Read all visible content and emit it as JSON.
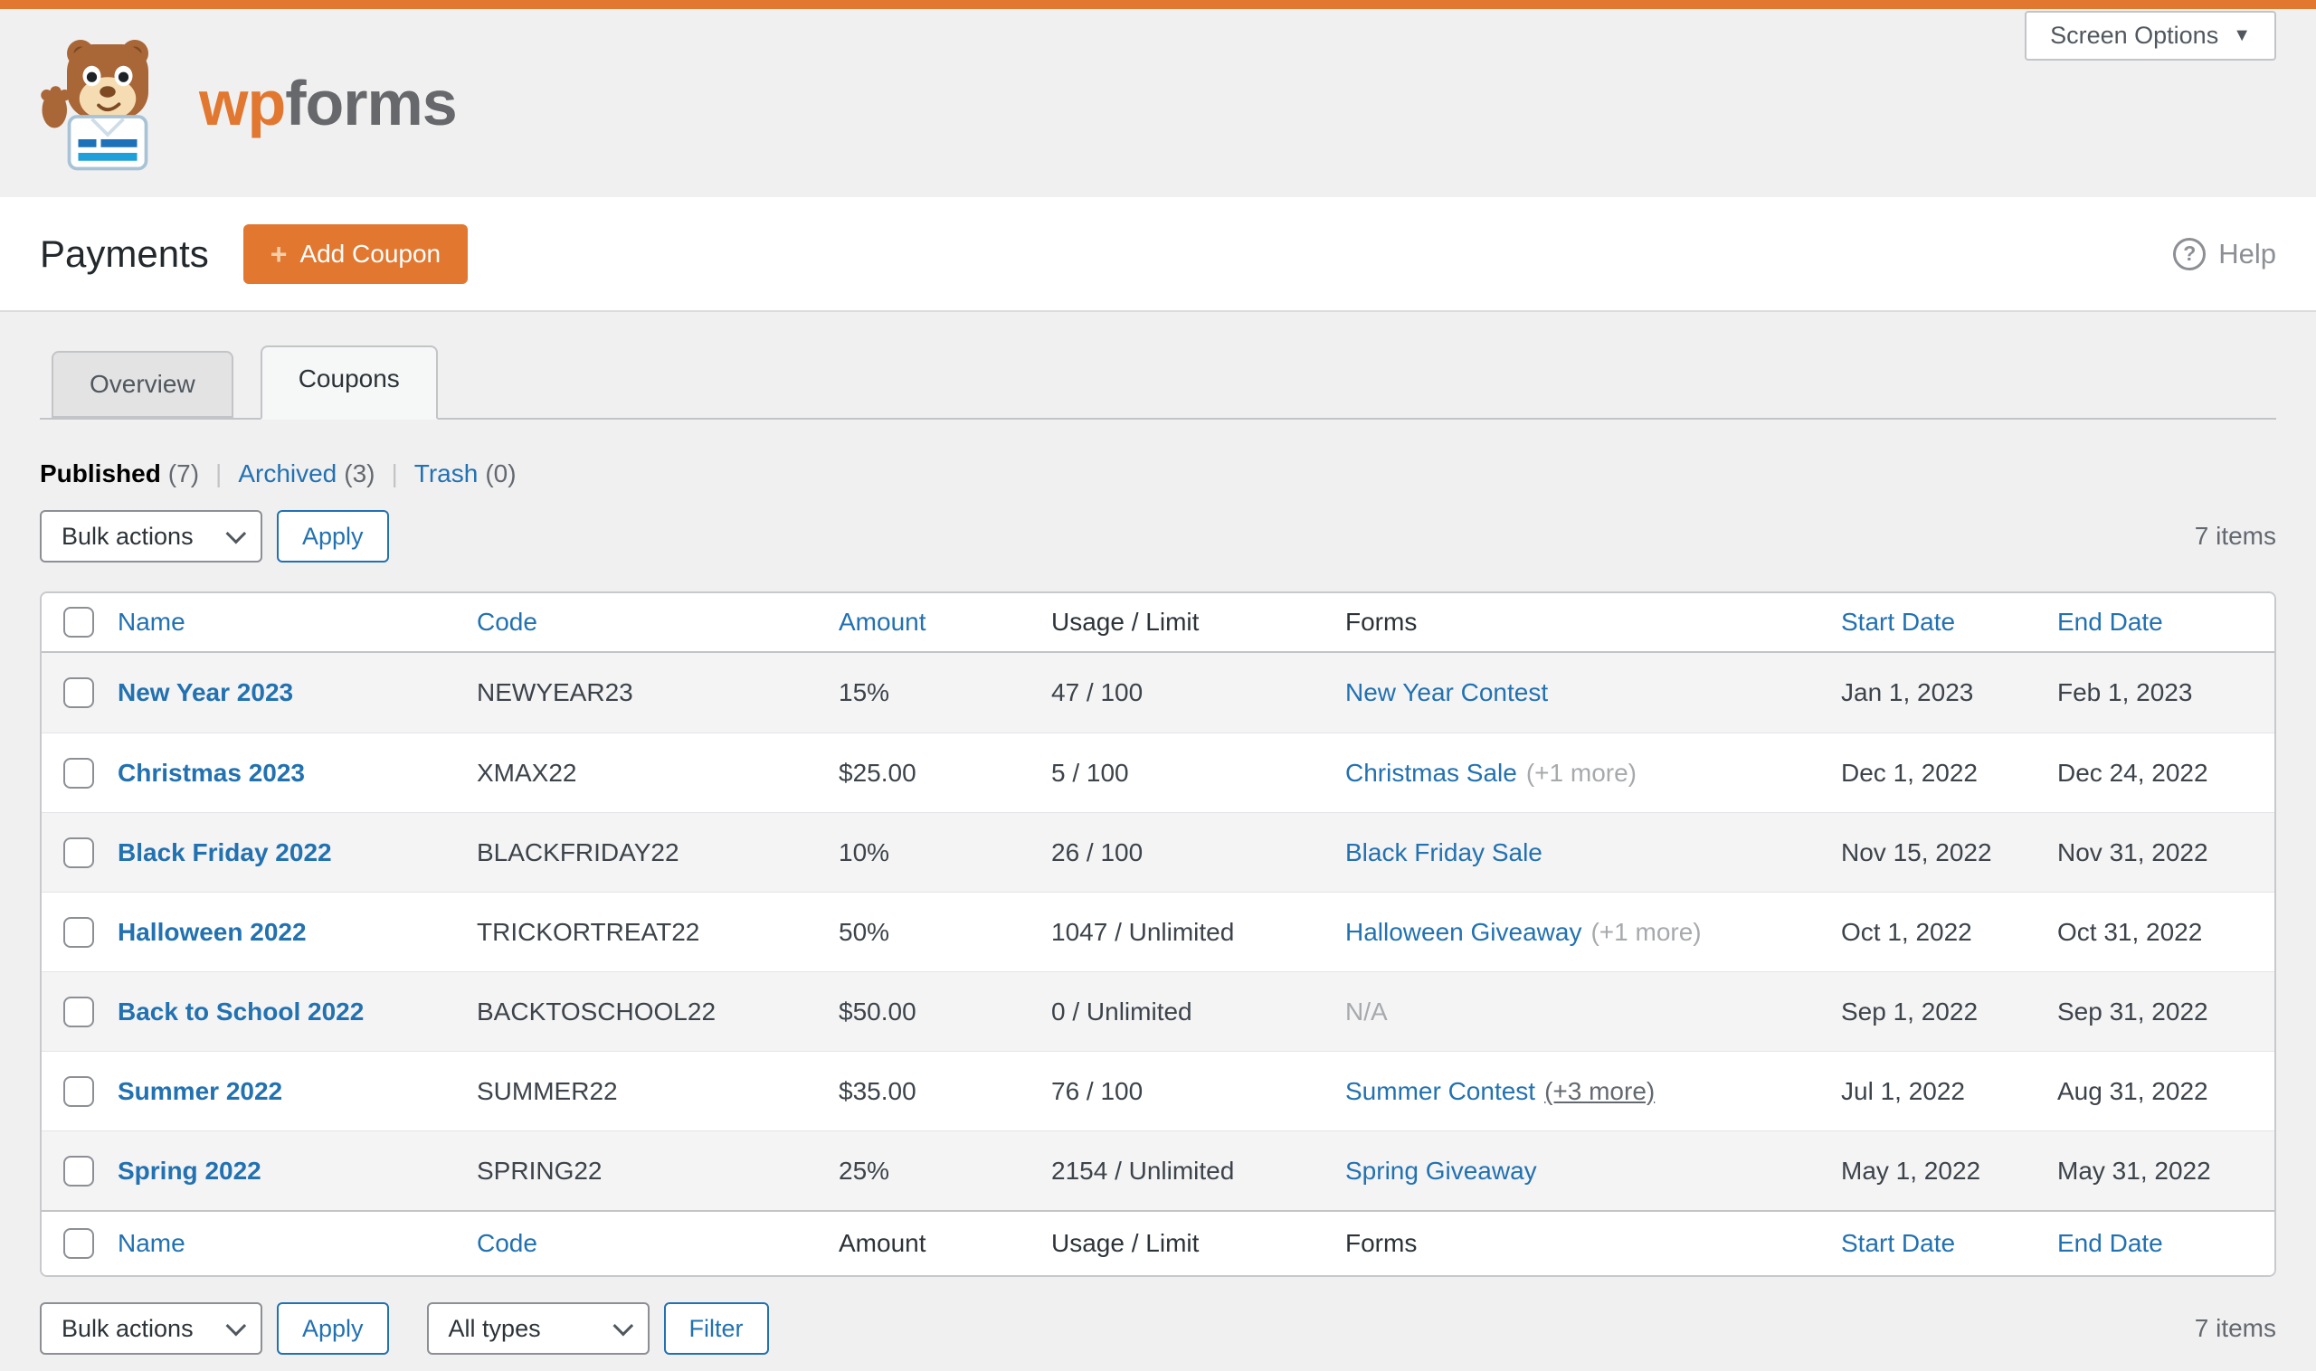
{
  "colors": {
    "accent_orange": "#e27730",
    "link_blue": "#2271b1"
  },
  "screen_options": {
    "label": "Screen Options",
    "caret": "▼"
  },
  "brand": {
    "wp": "wp",
    "forms": "forms"
  },
  "page_header": {
    "title": "Payments",
    "add_coupon_plus": "+",
    "add_coupon_label": "Add Coupon",
    "help_icon": "?",
    "help_label": "Help"
  },
  "tabs": [
    {
      "label": "Overview",
      "active": false
    },
    {
      "label": "Coupons",
      "active": true
    }
  ],
  "status_filters": [
    {
      "label": "Published",
      "count": "(7)",
      "current": true
    },
    {
      "label": "Archived",
      "count": "(3)",
      "current": false
    },
    {
      "label": "Trash",
      "count": "(0)",
      "current": false
    }
  ],
  "toolbar_top": {
    "bulk_actions": "Bulk actions",
    "apply": "Apply",
    "items_count": "7 items"
  },
  "toolbar_bottom": {
    "bulk_actions": "Bulk actions",
    "apply": "Apply",
    "type_filter": "All types",
    "filter": "Filter",
    "items_count": "7 items"
  },
  "table": {
    "header_cells": [
      {
        "label": "Name",
        "link": true
      },
      {
        "label": "Code",
        "link": true
      },
      {
        "label": "Amount",
        "link": true
      },
      {
        "label": "Usage / Limit",
        "link": false
      },
      {
        "label": "Forms",
        "link": false
      },
      {
        "label": "Start Date",
        "link": true
      },
      {
        "label": "End Date",
        "link": true
      }
    ],
    "footer_cells": [
      {
        "label": "Name",
        "link": true
      },
      {
        "label": "Code",
        "link": true
      },
      {
        "label": "Amount",
        "link": false
      },
      {
        "label": "Usage / Limit",
        "link": false
      },
      {
        "label": "Forms",
        "link": false
      },
      {
        "label": "Start Date",
        "link": true
      },
      {
        "label": "End Date",
        "link": true
      }
    ],
    "rows": [
      {
        "name": "New Year 2023",
        "code": "NEWYEAR23",
        "amount": "15%",
        "usage": "47 / 100",
        "form": "New Year Contest",
        "form_extra": "",
        "form_na": false,
        "extra_underline": false,
        "start": "Jan 1, 2023",
        "end": "Feb 1, 2023"
      },
      {
        "name": "Christmas 2023",
        "code": "XMAX22",
        "amount": "$25.00",
        "usage": "5 / 100",
        "form": "Christmas Sale",
        "form_extra": "(+1 more)",
        "form_na": false,
        "extra_underline": false,
        "start": "Dec 1, 2022",
        "end": "Dec 24, 2022"
      },
      {
        "name": "Black Friday 2022",
        "code": "BLACKFRIDAY22",
        "amount": "10%",
        "usage": "26 / 100",
        "form": "Black Friday Sale",
        "form_extra": "",
        "form_na": false,
        "extra_underline": false,
        "start": "Nov 15, 2022",
        "end": "Nov 31, 2022"
      },
      {
        "name": "Halloween 2022",
        "code": "TRICKORTREAT22",
        "amount": "50%",
        "usage": "1047 / Unlimited",
        "form": "Halloween Giveaway",
        "form_extra": "(+1 more)",
        "form_na": false,
        "extra_underline": false,
        "start": "Oct 1, 2022",
        "end": "Oct 31, 2022"
      },
      {
        "name": "Back to School 2022",
        "code": "BACKTOSCHOOL22",
        "amount": "$50.00",
        "usage": "0 / Unlimited",
        "form": "N/A",
        "form_extra": "",
        "form_na": true,
        "extra_underline": false,
        "start": "Sep 1, 2022",
        "end": "Sep 31, 2022"
      },
      {
        "name": "Summer 2022",
        "code": "SUMMER22",
        "amount": "$35.00",
        "usage": "76 / 100",
        "form": "Summer Contest",
        "form_extra": "(+3 more)",
        "form_na": false,
        "extra_underline": true,
        "start": "Jul 1, 2022",
        "end": "Aug 31, 2022"
      },
      {
        "name": "Spring 2022",
        "code": "SPRING22",
        "amount": "25%",
        "usage": "2154 / Unlimited",
        "form": "Spring Giveaway",
        "form_extra": "",
        "form_na": false,
        "extra_underline": false,
        "start": "May 1, 2022",
        "end": "May 31, 2022"
      }
    ]
  }
}
